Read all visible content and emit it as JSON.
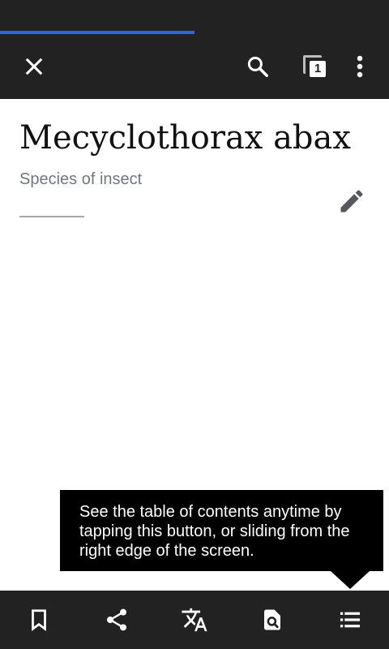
{
  "loading": {
    "progress_percent": 50
  },
  "toolbar": {
    "close_icon": "close-icon",
    "search_icon": "search-icon",
    "tabs_icon": "tabs-icon",
    "tab_count": "1",
    "overflow_icon": "more-vert-icon"
  },
  "article": {
    "title": "Mecyclothorax abax",
    "description": "Species of insect",
    "edit_icon": "pencil-icon"
  },
  "tooltip": {
    "text": "See the table of contents anytime by tapping this button, or sliding from the right edge of the screen."
  },
  "bottom_bar": {
    "items": [
      {
        "icon": "bookmark-icon"
      },
      {
        "icon": "share-icon"
      },
      {
        "icon": "translate-icon"
      },
      {
        "icon": "find-in-page-icon"
      },
      {
        "icon": "table-of-contents-icon"
      }
    ]
  },
  "colors": {
    "bars": "#222222",
    "progress": "#3366cc",
    "title": "#111111",
    "description": "#72777d",
    "tooltip_bg": "#000000"
  }
}
